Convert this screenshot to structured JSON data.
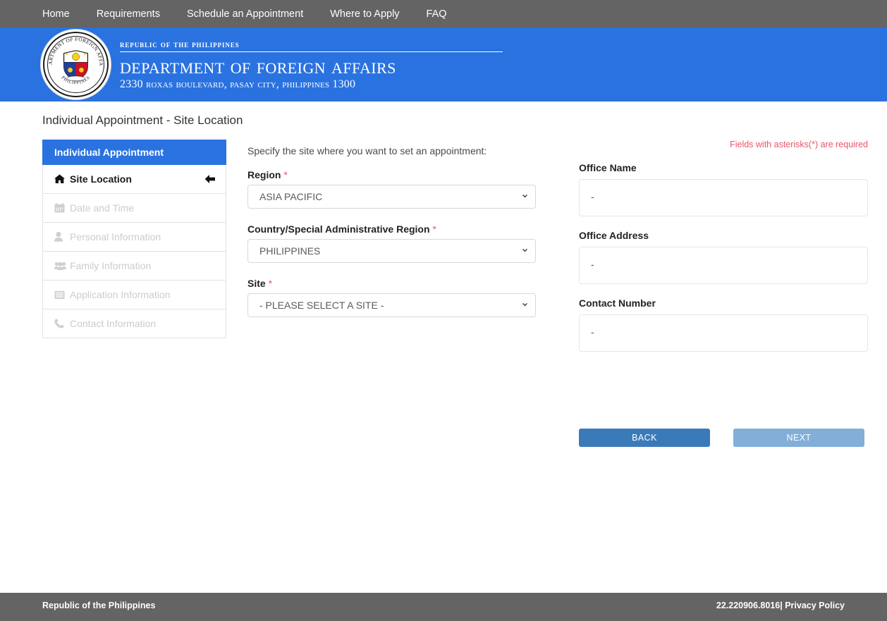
{
  "nav": {
    "items": [
      {
        "label": "Home"
      },
      {
        "label": "Requirements"
      },
      {
        "label": "Schedule an Appointment"
      },
      {
        "label": "Where to Apply"
      },
      {
        "label": "FAQ"
      }
    ]
  },
  "banner": {
    "republic": "Republic of the Philippines",
    "department": "Department of Foreign Affairs",
    "address": "2330 Roxas Boulevard, Pasay City, Philippines 1300",
    "seal_icon": "dfa-seal-icon",
    "background_color": "#2a72e0"
  },
  "page": {
    "title": "Individual Appointment - Site Location"
  },
  "sidebar": {
    "header": "Individual Appointment",
    "header_color": "#2a72e0",
    "items": [
      {
        "label": "Site Location",
        "icon": "home-icon",
        "state": "active"
      },
      {
        "label": "Date and Time",
        "icon": "calendar-icon",
        "state": "disabled"
      },
      {
        "label": "Personal Information",
        "icon": "user-icon",
        "state": "disabled"
      },
      {
        "label": "Family Information",
        "icon": "users-icon",
        "state": "disabled"
      },
      {
        "label": "Application Information",
        "icon": "list-icon",
        "state": "disabled"
      },
      {
        "label": "Contact Information",
        "icon": "phone-icon",
        "state": "disabled"
      }
    ],
    "active_arrow_icon": "arrow-left-icon"
  },
  "form": {
    "intro": "Specify the site where you want to set an appointment:",
    "required_marker": "*",
    "fields": [
      {
        "label": "Region",
        "required": true,
        "value": "ASIA PACIFIC"
      },
      {
        "label": "Country/Special Administrative Region",
        "required": true,
        "value": "PHILIPPINES"
      },
      {
        "label": "Site",
        "required": true,
        "value": "- PLEASE SELECT A SITE -"
      }
    ],
    "chevron_icon": "chevron-down-icon"
  },
  "office": {
    "required_note": "Fields with asterisks(*) are required",
    "required_note_color": "#e8556a",
    "fields": [
      {
        "label": "Office Name",
        "value": "-"
      },
      {
        "label": "Office Address",
        "value": "-"
      },
      {
        "label": "Contact Number",
        "value": "-"
      }
    ]
  },
  "buttons": {
    "back": "BACK",
    "next": "NEXT",
    "back_color": "#3b7ab8",
    "next_color": "#82aed8"
  },
  "footer": {
    "left": "Republic of the Philippines",
    "right": "22.220906.8016| Privacy Policy",
    "background_color": "#646464"
  }
}
